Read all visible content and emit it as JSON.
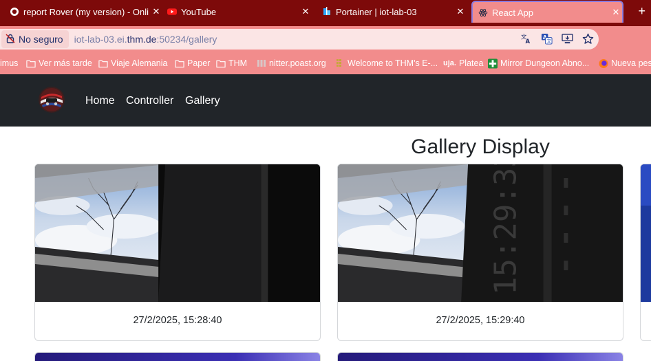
{
  "browser": {
    "tabs": [
      {
        "title": "report Rover (my version) - Onli",
        "icon": "opera-icon",
        "active": false
      },
      {
        "title": "YouTube",
        "icon": "youtube-icon",
        "active": false
      },
      {
        "title": "Portainer | iot-lab-03",
        "icon": "portainer-icon",
        "active": false
      },
      {
        "title": "React App",
        "icon": "react-icon",
        "active": true
      }
    ],
    "close_glyph": "✕",
    "new_tab_glyph": "+",
    "security_label": "No seguro",
    "url": {
      "prefix": "iot-lab-03.ei.",
      "host": "thm.de",
      "suffix": ":50234/gallery"
    },
    "omnibox_icons": [
      "translate-icon",
      "page-translate-icon",
      "install-app-icon",
      "bookmark-star-icon"
    ],
    "bookmarks": [
      {
        "label": "imus",
        "icon": ""
      },
      {
        "label": "Ver más tarde",
        "icon": "folder-icon"
      },
      {
        "label": "Viaje Alemania",
        "icon": "folder-icon"
      },
      {
        "label": "Paper",
        "icon": "folder-icon"
      },
      {
        "label": "THM",
        "icon": "folder-icon"
      },
      {
        "label": "nitter.poast.org",
        "icon": "nitter-icon"
      },
      {
        "label": "Welcome to THM's E-...",
        "icon": "moodle-icon"
      },
      {
        "label": "Platea",
        "icon": "uja-icon",
        "badge": "uja."
      },
      {
        "label": "Mirror Dungeon Abno...",
        "icon": "plus-cross-icon"
      },
      {
        "label": "Nueva pes",
        "icon": "firefox-icon"
      }
    ],
    "colors": {
      "tabbar": "#7d0a0a",
      "toolbar": "#f28c8c",
      "omnibox": "#fbe5e5"
    }
  },
  "app": {
    "navbar": {
      "links": [
        "Home",
        "Controller",
        "Gallery"
      ],
      "background": "#212529"
    },
    "title": "Gallery Display",
    "cards": [
      {
        "caption": "27/2/2025, 15:28:40",
        "image": "window-sky-photo"
      },
      {
        "caption": "27/2/2025, 15:29:40",
        "image": "window-sky-photo-with-timestamp-overlay"
      }
    ]
  }
}
